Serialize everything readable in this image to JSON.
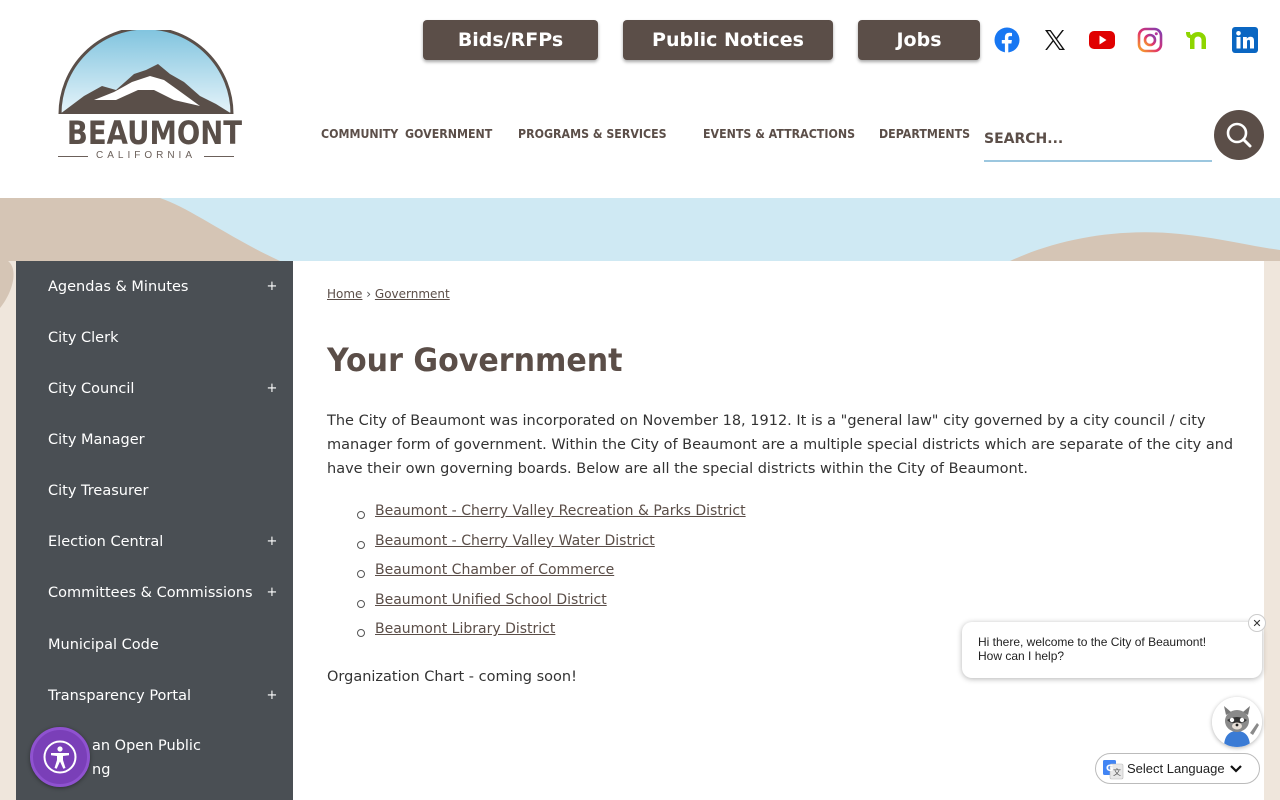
{
  "logo": {
    "name": "BEAUMONT",
    "sub": "CALIFORNIA"
  },
  "quick_links": [
    {
      "label": "Bids/RFPs"
    },
    {
      "label": "Public Notices"
    },
    {
      "label": "Jobs"
    }
  ],
  "social": [
    "facebook-icon",
    "x-twitter-icon",
    "youtube-icon",
    "instagram-icon",
    "nextdoor-icon",
    "linkedin-icon"
  ],
  "nav": [
    {
      "label": "COMMUNITY"
    },
    {
      "label": "GOVERNMENT"
    },
    {
      "label": "PROGRAMS & SERVICES"
    },
    {
      "label": "EVENTS & ATTRACTIONS"
    },
    {
      "label": "DEPARTMENTS"
    }
  ],
  "search": {
    "placeholder": "SEARCH..."
  },
  "sidebar": {
    "items": [
      {
        "label": "Agendas & Minutes",
        "expandable": "+"
      },
      {
        "label": "City Clerk",
        "expandable": ""
      },
      {
        "label": "City Council",
        "expandable": "+"
      },
      {
        "label": "City Manager",
        "expandable": ""
      },
      {
        "label": "City Treasurer",
        "expandable": ""
      },
      {
        "label": "Election Central",
        "expandable": "+"
      },
      {
        "label": "Committees & Commissions",
        "expandable": "+"
      },
      {
        "label": "Municipal Code",
        "expandable": ""
      },
      {
        "label": "Transparency Portal",
        "expandable": "+"
      },
      {
        "label": "an Open Public",
        "expandable": ""
      },
      {
        "label": "ng",
        "expandable": ""
      }
    ]
  },
  "breadcrumb": {
    "home": "Home",
    "sep": "›",
    "current": "Government"
  },
  "page": {
    "title": "Your Government",
    "intro": "The City of Beaumont was incorporated on November 18, 1912. It is a \"general law\" city governed by a city council / city manager form of government. Within the City of Beaumont are a multiple special districts which are separate of the city and have their own governing boards. Below are all the special districts within the City of Beaumont.",
    "districts": [
      "Beaumont - Cherry Valley Recreation & Parks District",
      "Beaumont - Cherry Valley Water District",
      "Beaumont Chamber of Commerce",
      "Beaumont Unified School District",
      "Beaumont Library District"
    ],
    "org_note": "Organization Chart - coming soon!"
  },
  "chat": {
    "greeting_line1": "Hi there, welcome to the City of Beaumont!",
    "greeting_line2": "How can I help?",
    "close": "✕"
  },
  "translate": {
    "label": "Select Language"
  },
  "colors": {
    "brand_brown": "#5b4e48",
    "sidebar": "#4a4f54",
    "sky": "#cfe9f3",
    "sand": "#d5c5b5",
    "accessibility": "#7a3fb8"
  }
}
